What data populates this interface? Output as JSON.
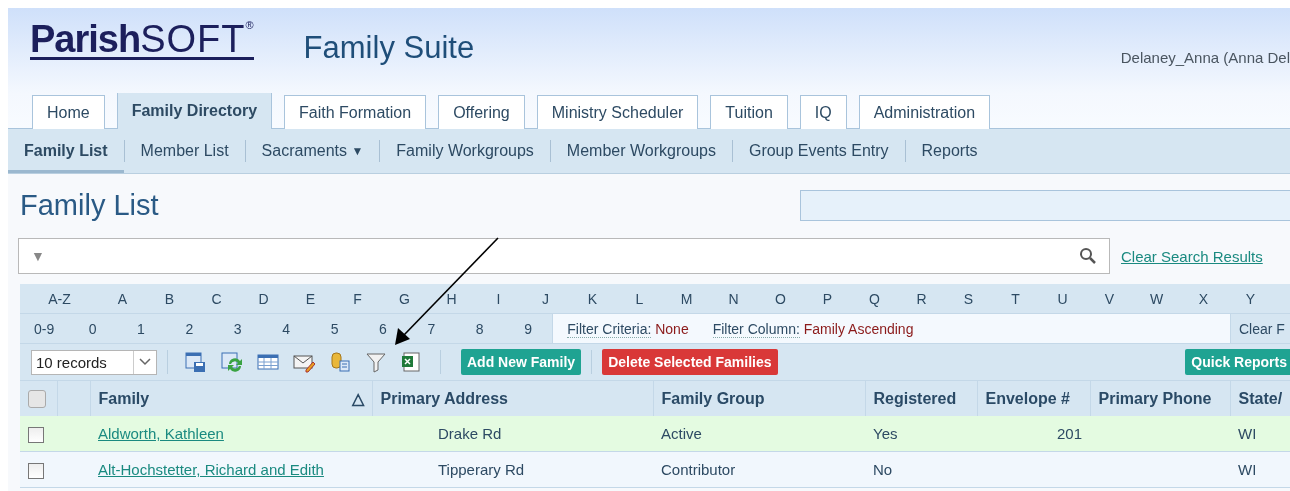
{
  "header": {
    "logo": {
      "name": "Parish",
      "suffix": "SOFT",
      "mark": "®"
    },
    "suite_title": "Family Suite",
    "user": "Delaney_Anna (Anna Del"
  },
  "tabs": [
    {
      "label": "Home",
      "selected": false
    },
    {
      "label": "Family Directory",
      "selected": true
    },
    {
      "label": "Faith Formation",
      "selected": false
    },
    {
      "label": "Offering",
      "selected": false
    },
    {
      "label": "Ministry Scheduler",
      "selected": false
    },
    {
      "label": "Tuition",
      "selected": false
    },
    {
      "label": "IQ",
      "selected": false
    },
    {
      "label": "Administration",
      "selected": false
    }
  ],
  "subnav": [
    {
      "label": "Family List",
      "selected": true
    },
    {
      "label": "Member List",
      "selected": false
    },
    {
      "label": "Sacraments",
      "selected": false,
      "dropdown": "▼"
    },
    {
      "label": "Family Workgroups",
      "selected": false
    },
    {
      "label": "Member Workgroups",
      "selected": false
    },
    {
      "label": "Group Events Entry",
      "selected": false
    },
    {
      "label": "Reports",
      "selected": false
    }
  ],
  "page_title": "Family List",
  "search": {
    "filter_toggle": "▼",
    "clear_link": "Clear Search Results"
  },
  "letters": [
    "A-Z",
    "A",
    "B",
    "C",
    "D",
    "E",
    "F",
    "G",
    "H",
    "I",
    "J",
    "K",
    "L",
    "M",
    "N",
    "O",
    "P",
    "Q",
    "R",
    "S",
    "T",
    "U",
    "V",
    "W",
    "X",
    "Y"
  ],
  "digits": [
    "0-9",
    "0",
    "1",
    "2",
    "3",
    "4",
    "5",
    "6",
    "7",
    "8",
    "9"
  ],
  "filter": {
    "criteria_label": "Filter Criteria:",
    "criteria_value": "None",
    "column_label": "Filter Column:",
    "column_value": "Family Ascending",
    "clear": "Clear F"
  },
  "toolbar": {
    "records": "10 records",
    "add_button": "Add New Family",
    "delete_button": "Delete Selected Families",
    "reports_button": "Quick Reports"
  },
  "table": {
    "select_all": {
      "checked": false
    },
    "columns": [
      {
        "label": "Family",
        "sort_mark": "△"
      },
      {
        "label": "Primary Address"
      },
      {
        "label": "Family Group"
      },
      {
        "label": "Registered"
      },
      {
        "label": "Envelope #"
      },
      {
        "label": "Primary Phone"
      },
      {
        "label": "State/"
      }
    ],
    "rows": [
      {
        "checked": false,
        "highlighted": true,
        "family": "Aldworth, Kathleen",
        "address": "Drake Rd",
        "group": "Active",
        "registered": "Yes",
        "envelope": "201",
        "state": "WI"
      },
      {
        "checked": false,
        "highlighted": false,
        "family": "Alt-Hochstetter, Richard and Edith",
        "address": "Tipperary Rd",
        "group": "Contributor",
        "registered": "No",
        "state": "WI"
      }
    ]
  }
}
